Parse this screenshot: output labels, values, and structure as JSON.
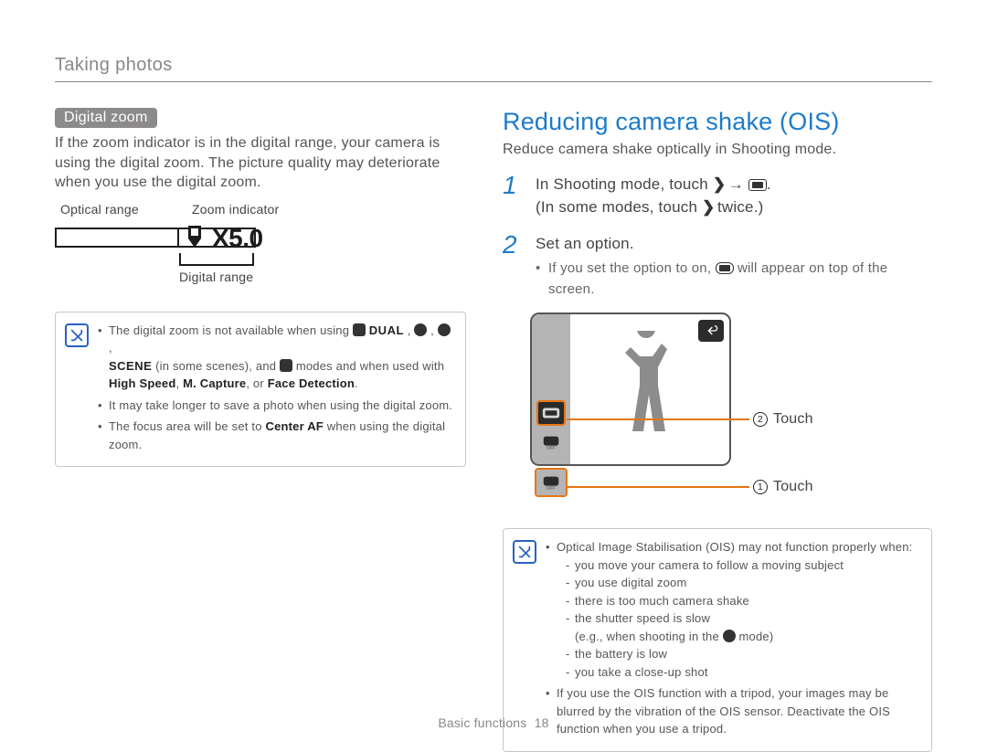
{
  "pageHeader": "Taking photos",
  "footer": {
    "section": "Basic functions",
    "page": "18"
  },
  "left": {
    "pill": "Digital zoom",
    "paragraph": "If the zoom indicator is in the digital range, your camera is using the digital zoom. The picture quality may deteriorate when you use the digital zoom.",
    "diagram": {
      "opticalLabel": "Optical range",
      "zoomIndicatorLabel": "Zoom indicator",
      "digitalLabel": "Digital range",
      "zoomValue": "X5.0"
    },
    "note": {
      "line1_a": "The digital zoom is not available when using ",
      "line1_b": "DUAL",
      "line1_c": " , ",
      "scene": "SCENE",
      "line2_a": " (in some scenes), and ",
      "line2_b": " modes and when used with ",
      "bold1": "High Speed",
      "bold2": "M. Capture",
      "bold3": "Face Detection",
      "bullet2": "It may take longer to save a photo when using the digital zoom.",
      "bullet3_a": "The focus area will be set to ",
      "bullet3_bold": "Center AF",
      "bullet3_b": " when using the digital zoom."
    }
  },
  "right": {
    "title": "Reducing camera shake (OIS)",
    "subtitle": "Reduce camera shake optically in Shooting mode.",
    "step1_a": "In Shooting mode, touch ",
    "step1_b": " → ",
    "step1_c": ".",
    "step1_line2_a": "(In some modes, touch ",
    "step1_line2_b": " twice.)",
    "step2": "Set an option.",
    "step2_sub_a": "If you set the option to on, ",
    "step2_sub_b": " will appear on top of the screen.",
    "callout1": "Touch",
    "callout2": "Touch",
    "note": {
      "b1": "Optical Image Stabilisation (OIS) may not function properly when:",
      "s1": "you move your camera to follow a moving subject",
      "s2": "you use digital zoom",
      "s3": "there is too much camera shake",
      "s4": "the shutter speed is slow",
      "s4b_a": "(e.g., when shooting in the ",
      "s4b_b": " mode)",
      "s5": "the battery is low",
      "s6": "you take a close-up shot",
      "b2": "If you use the OIS function with a tripod, your images may be blurred by the vibration of the OIS sensor. Deactivate the OIS function when you use a tripod."
    }
  }
}
